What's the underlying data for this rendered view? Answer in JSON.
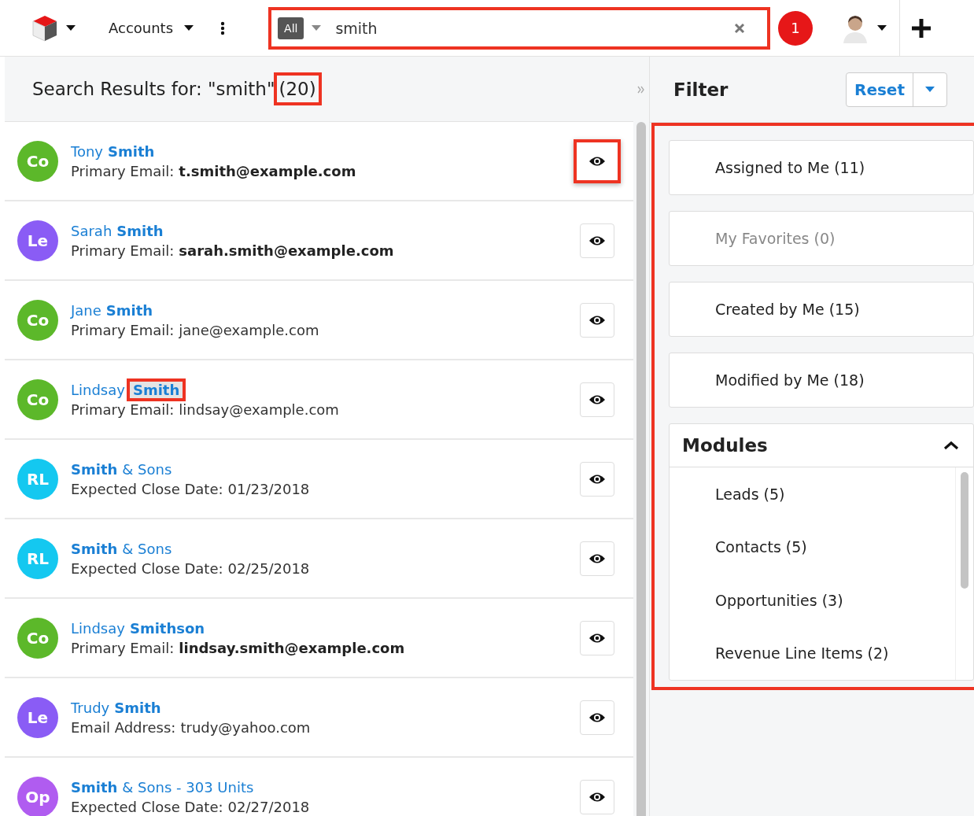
{
  "topbar": {
    "module_menu": "Accounts",
    "search": {
      "scope": "All",
      "value": "smith",
      "highlighted": true
    },
    "notifications": "1"
  },
  "results": {
    "title": "Search Results for: \"smith\"",
    "count": "(20)",
    "count_highlighted": true,
    "items": [
      {
        "initials": "Co",
        "color": "#5cb82a",
        "name": [
          {
            "text": "Tony",
            "match": false,
            "highlighted": false
          },
          {
            "text": "Smith",
            "match": true,
            "highlighted": false
          }
        ],
        "label": "Primary Email:",
        "value": "t.smith@example.com",
        "value_bold": true,
        "preview_highlighted": true
      },
      {
        "initials": "Le",
        "color": "#8a5cf5",
        "name": [
          {
            "text": "Sarah",
            "match": false,
            "highlighted": false
          },
          {
            "text": "Smith",
            "match": true,
            "highlighted": false
          }
        ],
        "label": "Primary Email:",
        "value": "sarah.smith@example.com",
        "value_bold": true,
        "preview_highlighted": false
      },
      {
        "initials": "Co",
        "color": "#5cb82a",
        "name": [
          {
            "text": "Jane",
            "match": false,
            "highlighted": false
          },
          {
            "text": "Smith",
            "match": true,
            "highlighted": false
          }
        ],
        "label": "Primary Email:",
        "value": "jane@example.com",
        "value_bold": false,
        "preview_highlighted": false
      },
      {
        "initials": "Co",
        "color": "#5cb82a",
        "name": [
          {
            "text": "Lindsay",
            "match": false,
            "highlighted": false
          },
          {
            "text": "Smith",
            "match": true,
            "highlighted": true
          }
        ],
        "label": "Primary Email:",
        "value": "lindsay@example.com",
        "value_bold": false,
        "preview_highlighted": false
      },
      {
        "initials": "RL",
        "color": "#14c8f0",
        "name": [
          {
            "text": "Smith",
            "match": true,
            "highlighted": false
          },
          {
            "text": "& Sons",
            "match": false,
            "highlighted": false
          }
        ],
        "label": "Expected Close Date:",
        "value": "01/23/2018",
        "value_bold": false,
        "preview_highlighted": false
      },
      {
        "initials": "RL",
        "color": "#14c8f0",
        "name": [
          {
            "text": "Smith",
            "match": true,
            "highlighted": false
          },
          {
            "text": "& Sons",
            "match": false,
            "highlighted": false
          }
        ],
        "label": "Expected Close Date:",
        "value": "02/25/2018",
        "value_bold": false,
        "preview_highlighted": false
      },
      {
        "initials": "Co",
        "color": "#5cb82a",
        "name": [
          {
            "text": "Lindsay",
            "match": false,
            "highlighted": false
          },
          {
            "text": "Smithson",
            "match": true,
            "highlighted": false
          }
        ],
        "label": "Primary Email:",
        "value": "lindsay.smith@example.com",
        "value_bold": true,
        "preview_highlighted": false
      },
      {
        "initials": "Le",
        "color": "#8a5cf5",
        "name": [
          {
            "text": "Trudy",
            "match": false,
            "highlighted": false
          },
          {
            "text": "Smith",
            "match": true,
            "highlighted": false
          }
        ],
        "label": "Email Address:",
        "value": "trudy@yahoo.com",
        "value_bold": false,
        "preview_highlighted": false
      },
      {
        "initials": "Op",
        "color": "#b05cf0",
        "name": [
          {
            "text": "Smith",
            "match": true,
            "highlighted": false
          },
          {
            "text": "& Sons - 303 Units",
            "match": false,
            "highlighted": false
          }
        ],
        "label": "Expected Close Date:",
        "value": "02/27/2018",
        "value_bold": false,
        "preview_highlighted": false
      }
    ]
  },
  "filter": {
    "title": "Filter",
    "reset": "Reset",
    "highlighted": true,
    "quick_filters": [
      {
        "label": "Assigned to Me (11)",
        "disabled": false
      },
      {
        "label": "My Favorites (0)",
        "disabled": true
      },
      {
        "label": "Created by Me (15)",
        "disabled": false
      },
      {
        "label": "Modified by Me (18)",
        "disabled": false
      }
    ],
    "modules": {
      "title": "Modules",
      "expanded": true,
      "items": [
        "Leads (5)",
        "Contacts (5)",
        "Opportunities (3)",
        "Revenue Line Items (2)"
      ]
    }
  }
}
